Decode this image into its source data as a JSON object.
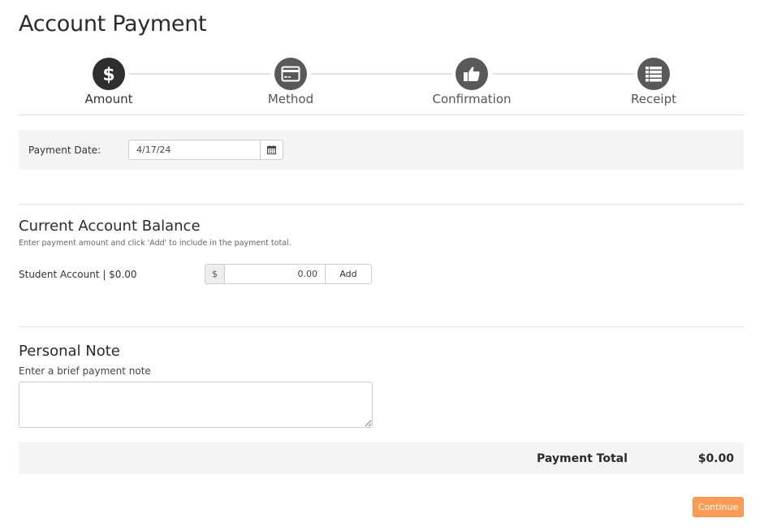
{
  "page": {
    "title": "Account Payment"
  },
  "stepper": {
    "steps": [
      {
        "label": "Amount",
        "icon": "dollar-icon",
        "active": true
      },
      {
        "label": "Method",
        "icon": "credit-card-icon",
        "active": false
      },
      {
        "label": "Confirmation",
        "icon": "thumbs-up-icon",
        "active": false
      },
      {
        "label": "Receipt",
        "icon": "list-icon",
        "active": false
      }
    ]
  },
  "payment_date": {
    "label": "Payment Date:",
    "value": "4/17/24",
    "button_icon": "calendar-icon"
  },
  "balance": {
    "title": "Current Account Balance",
    "hint": "Enter payment amount and click 'Add' to include in the payment total.",
    "account_label": "Student Account | $0.00",
    "currency_addon": "$",
    "amount_value": "0.00",
    "add_label": "Add"
  },
  "note": {
    "title": "Personal Note",
    "label": "Enter a brief payment note",
    "value": ""
  },
  "total": {
    "label": "Payment Total",
    "value": "$0.00"
  },
  "actions": {
    "continue_label": "Continue",
    "continue_color": "#ff9b55"
  },
  "colors": {
    "step_active": "#2f2f2f",
    "step_inactive": "#595959",
    "panel_bg": "#f4f4f4"
  }
}
